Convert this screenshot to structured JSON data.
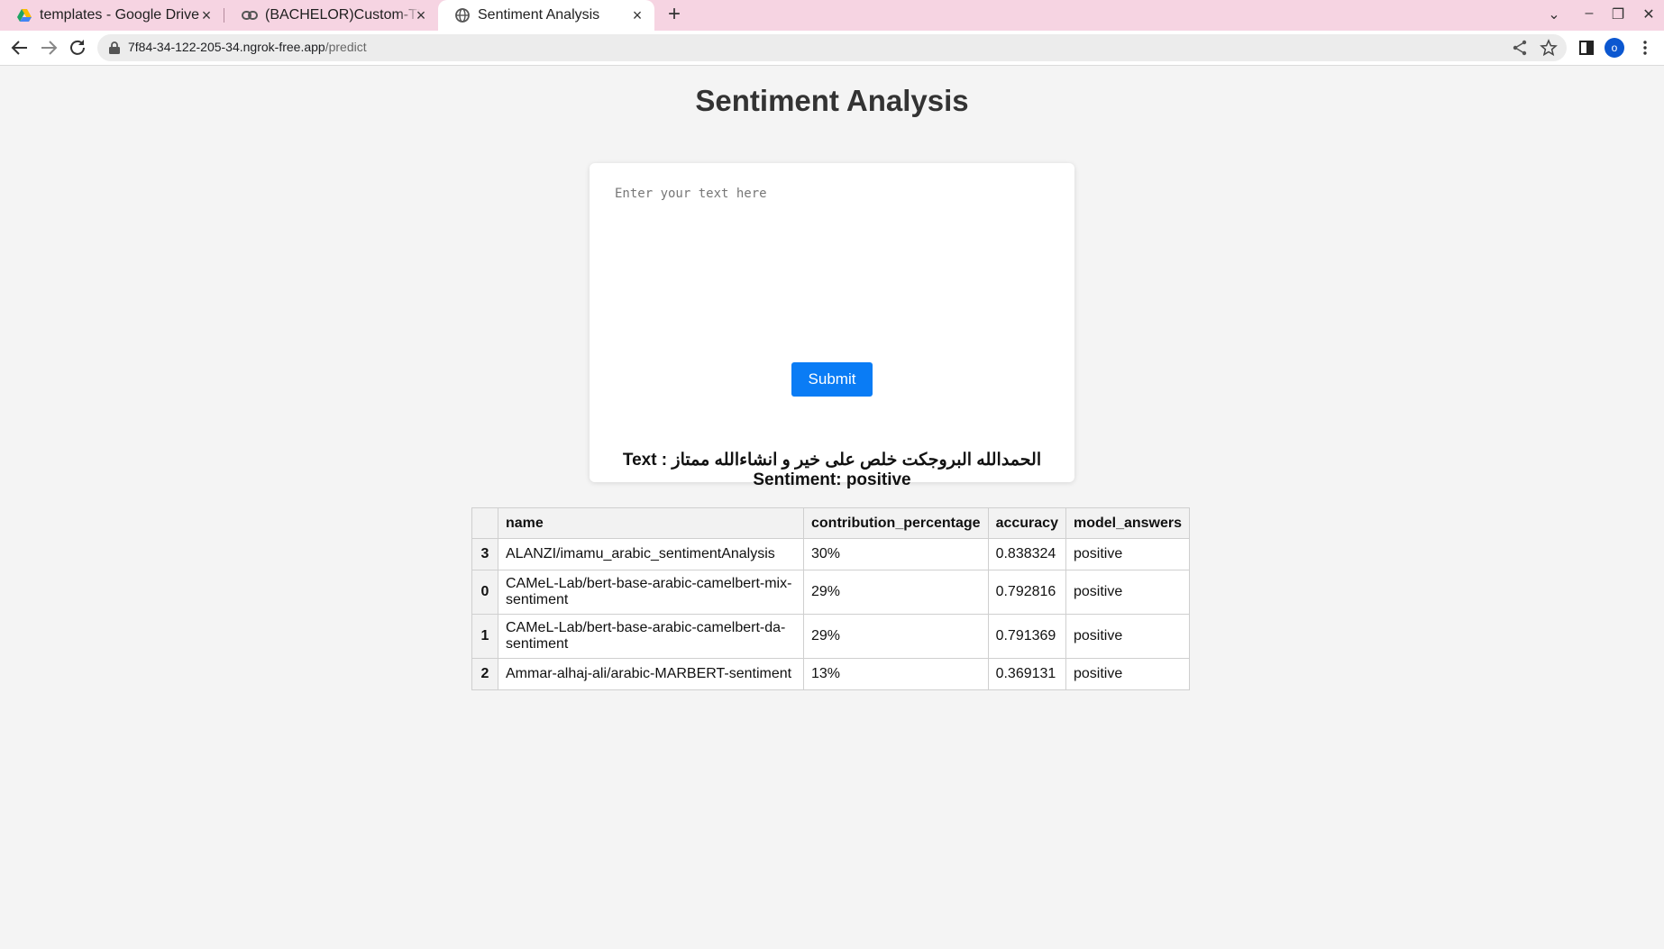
{
  "browser": {
    "tabs": [
      {
        "title": "templates - Google Drive",
        "icon": "google-drive-icon"
      },
      {
        "title": "(BACHELOR)Custom-TRA",
        "icon": "link-icon"
      },
      {
        "title": "Sentiment Analysis",
        "icon": "globe-icon",
        "active": true
      }
    ],
    "url_host": "7f84-34-122-205-34.ngrok-free.app",
    "url_path": "/predict",
    "profile_initial": "o"
  },
  "page": {
    "title": "Sentiment Analysis",
    "textarea_placeholder": "Enter your text here",
    "submit_label": "Submit",
    "result_text_line": "Text : الحمدالله البروجكت خلص على خير و انشاءالله ممتاز",
    "result_sentiment_line": "Sentiment: positive"
  },
  "table": {
    "headers": [
      "",
      "name",
      "contribution_percentage",
      "accuracy",
      "model_answers"
    ],
    "rows": [
      {
        "index": "3",
        "name": "ALANZI/imamu_arabic_sentimentAnalysis",
        "contribution_percentage": "30%",
        "accuracy": "0.838324",
        "model_answers": "positive"
      },
      {
        "index": "0",
        "name": "CAMeL-Lab/bert-base-arabic-camelbert-mix-sentiment",
        "contribution_percentage": "29%",
        "accuracy": "0.792816",
        "model_answers": "positive"
      },
      {
        "index": "1",
        "name": "CAMeL-Lab/bert-base-arabic-camelbert-da-sentiment",
        "contribution_percentage": "29%",
        "accuracy": "0.791369",
        "model_answers": "positive"
      },
      {
        "index": "2",
        "name": "Ammar-alhaj-ali/arabic-MARBERT-sentiment",
        "contribution_percentage": "13%",
        "accuracy": "0.369131",
        "model_answers": "positive"
      }
    ]
  },
  "colors": {
    "tabstrip": "#f6d4e2",
    "submit": "#0a7cf5",
    "page_bg": "#f4f4f4"
  }
}
